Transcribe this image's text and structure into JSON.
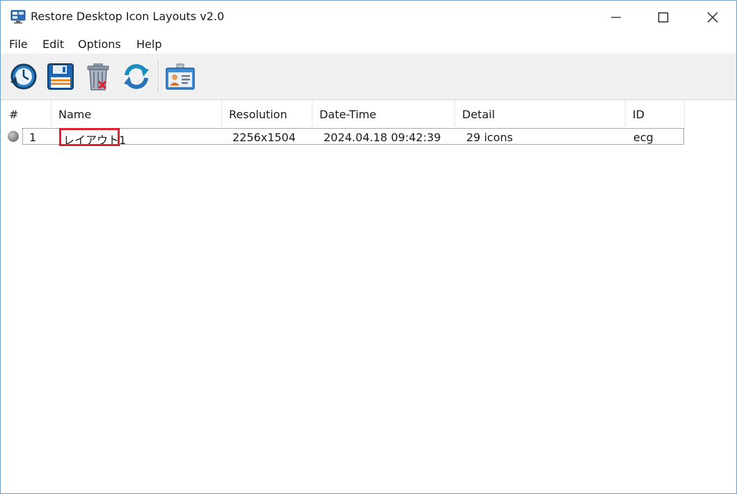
{
  "window": {
    "title": "Restore Desktop Icon Layouts v2.0"
  },
  "menu": {
    "items": [
      "File",
      "Edit",
      "Options",
      "Help"
    ]
  },
  "toolbar": {
    "buttons": [
      {
        "icon": "restore-clock-icon"
      },
      {
        "icon": "save-icon"
      },
      {
        "icon": "trash-icon"
      },
      {
        "icon": "refresh-icon"
      },
      {
        "icon": "id-card-icon"
      }
    ]
  },
  "table": {
    "columns": [
      "#",
      "Name",
      "Resolution",
      "Date-Time",
      "Detail",
      "ID"
    ],
    "rows": [
      {
        "num": "1",
        "name": "レイアウト1",
        "resolution": "2256x1504",
        "datetime": "2024.04.18 09:42:39",
        "detail": "29 icons",
        "id": "ecg"
      }
    ]
  },
  "colors": {
    "highlight_border": "#e0202c",
    "toolbar_bg": "#f0f0f0",
    "window_border": "#6f9bc9"
  }
}
